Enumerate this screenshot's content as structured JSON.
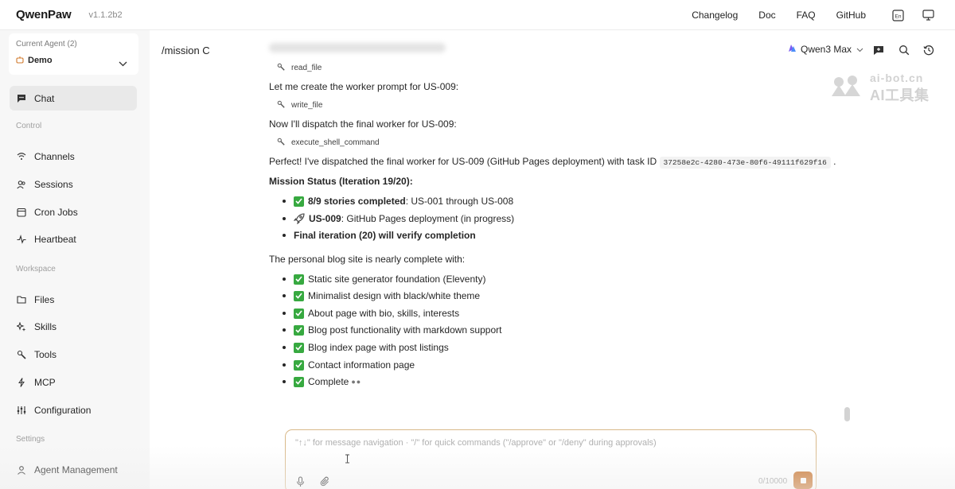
{
  "app": {
    "name": "QwenPaw",
    "version": "v1.1.2b2"
  },
  "topnav": {
    "changelog": "Changelog",
    "doc": "Doc",
    "faq": "FAQ",
    "github": "GitHub"
  },
  "sidebar": {
    "agent_label": "Current Agent (2)",
    "agent_name": "Demo",
    "items": [
      {
        "label": "Chat",
        "icon": "chat-icon"
      },
      {
        "label": "Channels",
        "icon": "wifi-icon"
      },
      {
        "label": "Sessions",
        "icon": "users-icon"
      },
      {
        "label": "Cron Jobs",
        "icon": "clock-icon"
      },
      {
        "label": "Heartbeat",
        "icon": "heartbeat-icon"
      },
      {
        "label": "Files",
        "icon": "folder-icon"
      },
      {
        "label": "Skills",
        "icon": "sparkle-icon"
      },
      {
        "label": "Tools",
        "icon": "wrench-icon"
      },
      {
        "label": "MCP",
        "icon": "plug-icon"
      },
      {
        "label": "Configuration",
        "icon": "sliders-icon"
      },
      {
        "label": "Agent Management",
        "icon": "agents-icon"
      }
    ],
    "sections": {
      "control": "Control",
      "workspace": "Workspace",
      "settings": "Settings"
    }
  },
  "main": {
    "title": "/mission C",
    "model": "Qwen3 Max",
    "watermark": {
      "top": "ai-bot.cn",
      "bottom": "AI工具集"
    },
    "messages": {
      "tool_read": "read_file",
      "p1": "Let me create the worker prompt for US-009:",
      "tool_write": "write_file",
      "p2": "Now I'll dispatch the final worker for US-009:",
      "tool_exec": "execute_shell_command",
      "p3": "Perfect! I've dispatched the final worker for US-009 (GitHub Pages deployment) with task ID",
      "task_id": "37258e2c-4280-473e-80f6-49111f629f16",
      "p3_end": ".",
      "status_heading": "Mission Status (Iteration 19/20):",
      "status": [
        {
          "bold": "8/9 stories completed",
          "rest": ": US-001 through US-008"
        },
        {
          "bold": "US-009",
          "rest": ": GitHub Pages deployment (in progress)"
        },
        {
          "bold": "Final iteration (20) will verify completion",
          "rest": ""
        }
      ],
      "summary": "The personal blog site is nearly complete with:",
      "features": [
        "Static site generator foundation (Eleventy)",
        "Minimalist design with black/white theme",
        "About page with bio, skills, interests",
        "Blog post functionality with markdown support",
        "Blog index page with post listings",
        "Contact information page",
        "Complete"
      ]
    }
  },
  "input": {
    "placeholder": "\"↑↓\" for message navigation · \"/\" for quick commands (\"/approve\" or \"/deny\" during approvals)",
    "counter": "0/10000"
  },
  "colors": {
    "accent": "#c8722a",
    "check": "#37a940",
    "active_nav": "#e9e9e9"
  }
}
